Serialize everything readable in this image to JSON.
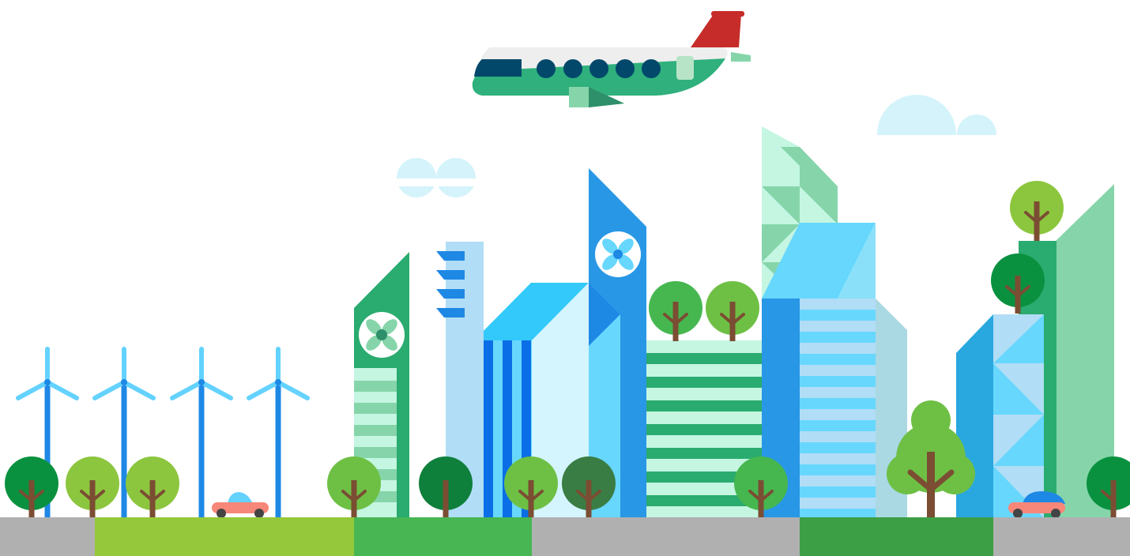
{
  "palette": {
    "sky": "#ffffff",
    "cloud": "#d4f3fb",
    "ground_grey": "#b0b0b0",
    "ground_lime": "#95c83a",
    "ground_green": "#47b653",
    "ground_dark_green": "#3d9f45",
    "turbine_blue": "#1e88e5",
    "turbine_blade": "#64d2ff",
    "plane_body": "#eeeeee",
    "plane_belly": "#2fb07c",
    "plane_tail": "#c62d2a",
    "plane_window": "#01486b",
    "building_green": "#2aab6f",
    "building_light_green": "#86d5aa",
    "building_mint": "#c4f6e2",
    "building_blue": "#2897e6",
    "building_sky": "#67d7fd",
    "building_pale": "#b1ddf6",
    "tree_trunk": "#7b4d33",
    "tree_green": "#46b74f",
    "tree_lime": "#8cc63f",
    "tree_dark": "#0a9140",
    "car_pink": "#f78778",
    "car_blue": "#1e88e5"
  }
}
